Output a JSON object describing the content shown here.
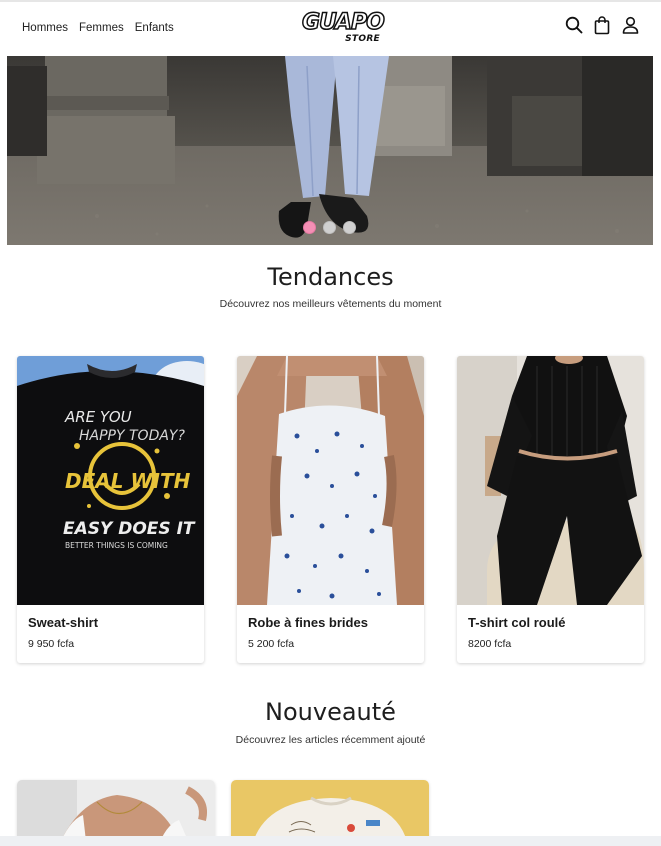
{
  "header": {
    "nav": [
      "Hommes",
      "Femmes",
      "Enfants"
    ],
    "logo_main": "GUAPO",
    "logo_sub": "STORE",
    "icons": [
      "search-icon",
      "bag-icon",
      "user-icon"
    ]
  },
  "hero": {
    "slides_total": 3,
    "active_slide": 1,
    "colors": {
      "active_dot": "#f58fb5",
      "inactive_dot": "#d0d0d0"
    }
  },
  "trends": {
    "title": "Tendances",
    "subtitle": "Découvrez nos meilleurs vêtements du moment",
    "products": [
      {
        "name": "Sweat-shirt",
        "price": "9 950 fcfa",
        "print_lines": [
          "ARE YOU",
          "HAPPY TODAY?",
          "DEAL WITH",
          "EASY DOES IT",
          "BETTER THINGS IS COMING"
        ]
      },
      {
        "name": "Robe à fines brides",
        "price": "5 200 fcfa"
      },
      {
        "name": "T-shirt col roulé",
        "price": "8200 fcfa"
      }
    ]
  },
  "news": {
    "title": "Nouveauté",
    "subtitle": "Découvrez les articles récemment ajouté"
  }
}
